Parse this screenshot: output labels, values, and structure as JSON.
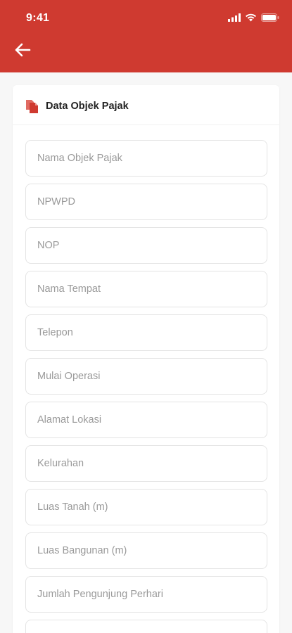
{
  "status_bar": {
    "time": "9:41"
  },
  "header": {
    "background_color": "#cf3a30",
    "back_icon": "arrow-left-icon"
  },
  "form": {
    "section_title": "Data Objek Pajak",
    "section_icon": "document-icon",
    "fields": [
      {
        "placeholder": "Nama Objek Pajak",
        "value": ""
      },
      {
        "placeholder": "NPWPD",
        "value": ""
      },
      {
        "placeholder": "NOP",
        "value": ""
      },
      {
        "placeholder": "Nama Tempat",
        "value": ""
      },
      {
        "placeholder": "Telepon",
        "value": ""
      },
      {
        "placeholder": "Mulai Operasi",
        "value": ""
      },
      {
        "placeholder": "Alamat Lokasi",
        "value": ""
      },
      {
        "placeholder": "Kelurahan",
        "value": ""
      },
      {
        "placeholder": "Luas Tanah (m)",
        "value": ""
      },
      {
        "placeholder": "Luas Bangunan (m)",
        "value": ""
      },
      {
        "placeholder": "Jumlah Pengunjung Perhari",
        "value": ""
      },
      {
        "placeholder": "",
        "value": ""
      }
    ]
  }
}
